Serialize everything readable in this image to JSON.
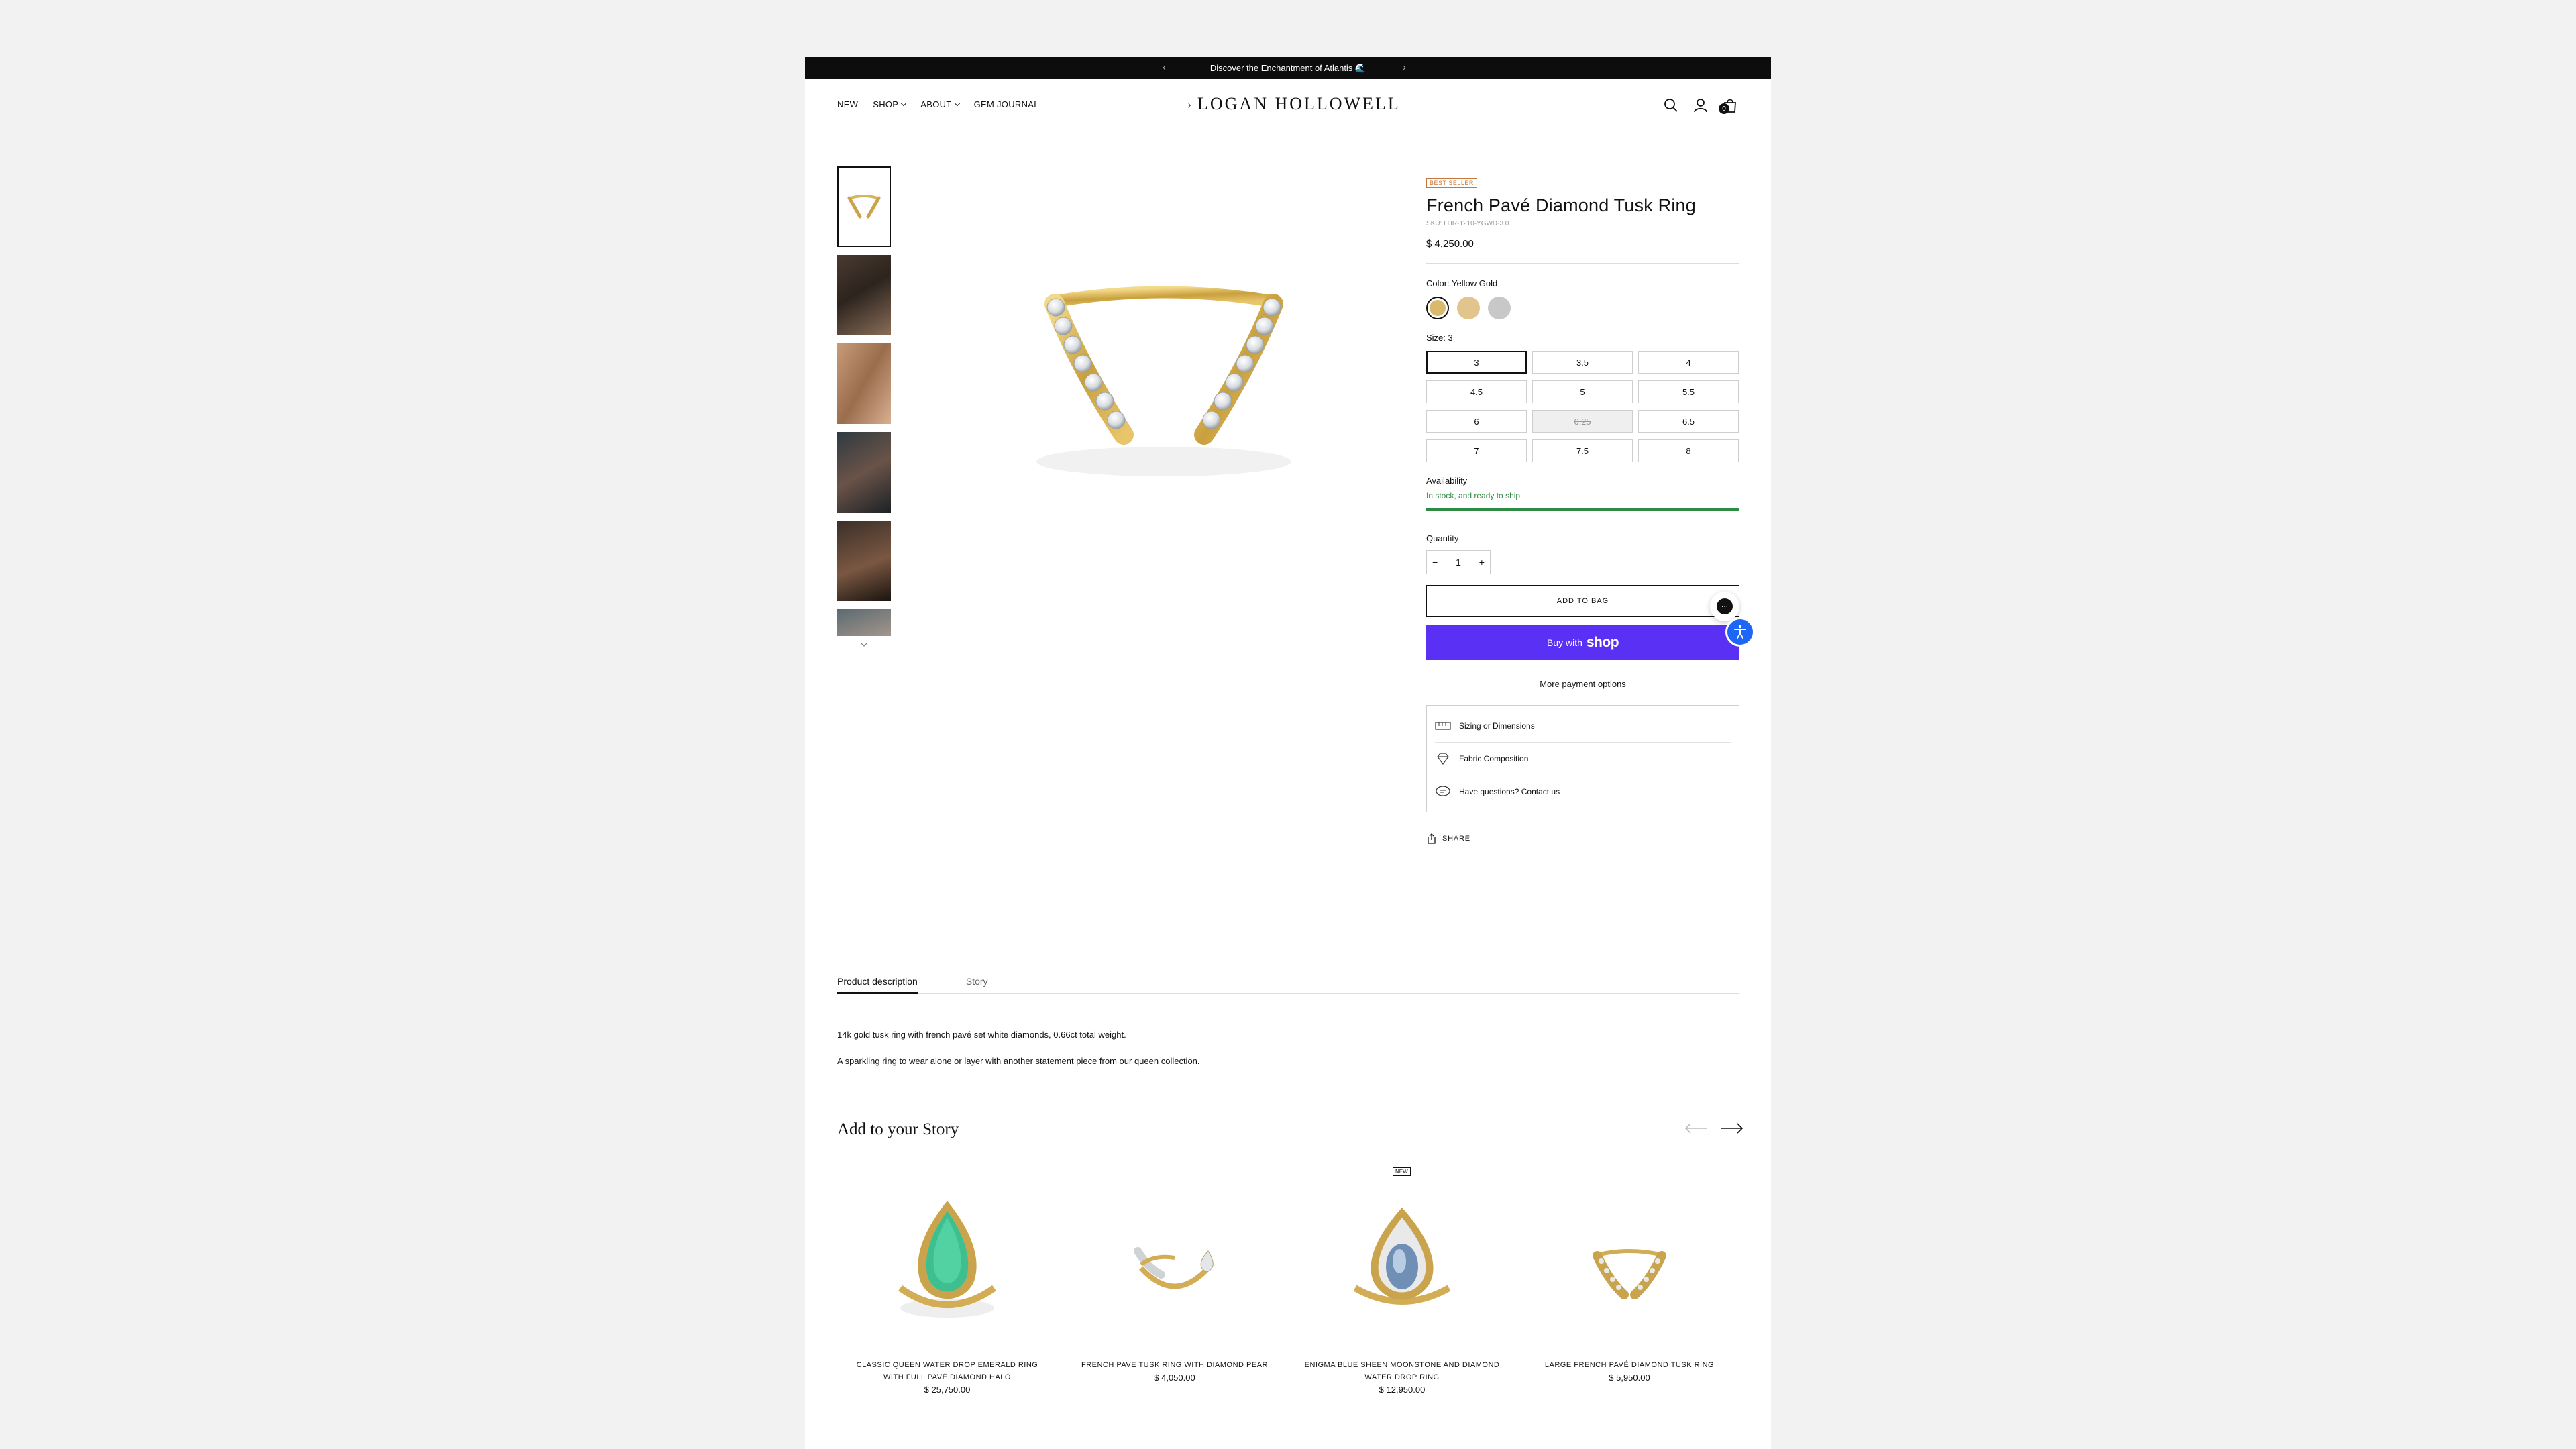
{
  "announcement": {
    "text": "Discover the Enchantment of Atlantis 🌊"
  },
  "nav": {
    "items": [
      "NEW",
      "SHOP",
      "ABOUT",
      "GEM JOURNAL"
    ]
  },
  "brand": {
    "logo": "LOGAN HOLLOWELL"
  },
  "header": {
    "cart_count": "0"
  },
  "product": {
    "badge": "BEST SELLER",
    "title": "French Pavé Diamond Tusk Ring",
    "sku": "SKU: LHR-1210-YGWD-3.0",
    "price": "$ 4,250.00",
    "color_label": "Color: Yellow Gold",
    "colors": [
      {
        "name": "Yellow Gold",
        "hex": "#d9b96b",
        "selected": true
      },
      {
        "name": "Rose Gold",
        "hex": "#e2c48d",
        "selected": false
      },
      {
        "name": "White Gold",
        "hex": "#c8c8c8",
        "selected": false
      }
    ],
    "size_label": "Size: 3",
    "sizes": [
      "3",
      "3.5",
      "4",
      "4.5",
      "5",
      "5.5",
      "6",
      "6.25",
      "6.5",
      "7",
      "7.5",
      "8"
    ],
    "availability_label": "Availability",
    "availability_text": "In stock, and ready to ship",
    "quantity_label": "Quantity",
    "quantity": "1",
    "add_to_bag": "ADD TO BAG",
    "buy_with": "Buy with",
    "shop_word": "shop",
    "more_payment": "More payment options",
    "info_rows": [
      "Sizing or Dimensions",
      "Fabric Composition",
      "Have questions? Contact us"
    ],
    "share": "SHARE"
  },
  "tabs": [
    "Product description",
    "Story"
  ],
  "description": [
    "14k gold tusk ring with french pavé set white diamonds, 0.66ct total weight.",
    "A sparkling ring to wear alone or layer with another statement piece from our queen collection."
  ],
  "recommendations": {
    "title": "Add to your Story",
    "items": [
      {
        "name": "CLASSIC QUEEN WATER DROP EMERALD RING WITH FULL PAVÉ DIAMOND HALO",
        "price": "$ 25,750.00",
        "badge": ""
      },
      {
        "name": "FRENCH PAVE TUSK RING WITH DIAMOND PEAR",
        "price": "$ 4,050.00",
        "badge": ""
      },
      {
        "name": "ENIGMA BLUE SHEEN MOONSTONE AND DIAMOND WATER DROP RING",
        "price": "$ 12,950.00",
        "badge": "NEW"
      },
      {
        "name": "LARGE FRENCH PAVÉ DIAMOND TUSK RING",
        "price": "$ 5,950.00",
        "badge": ""
      }
    ]
  },
  "colors": {
    "accent_shop": "#5a31f4",
    "in_stock": "#2f8a43",
    "badge": "#c7773a",
    "accessibility": "#1e66f5"
  }
}
